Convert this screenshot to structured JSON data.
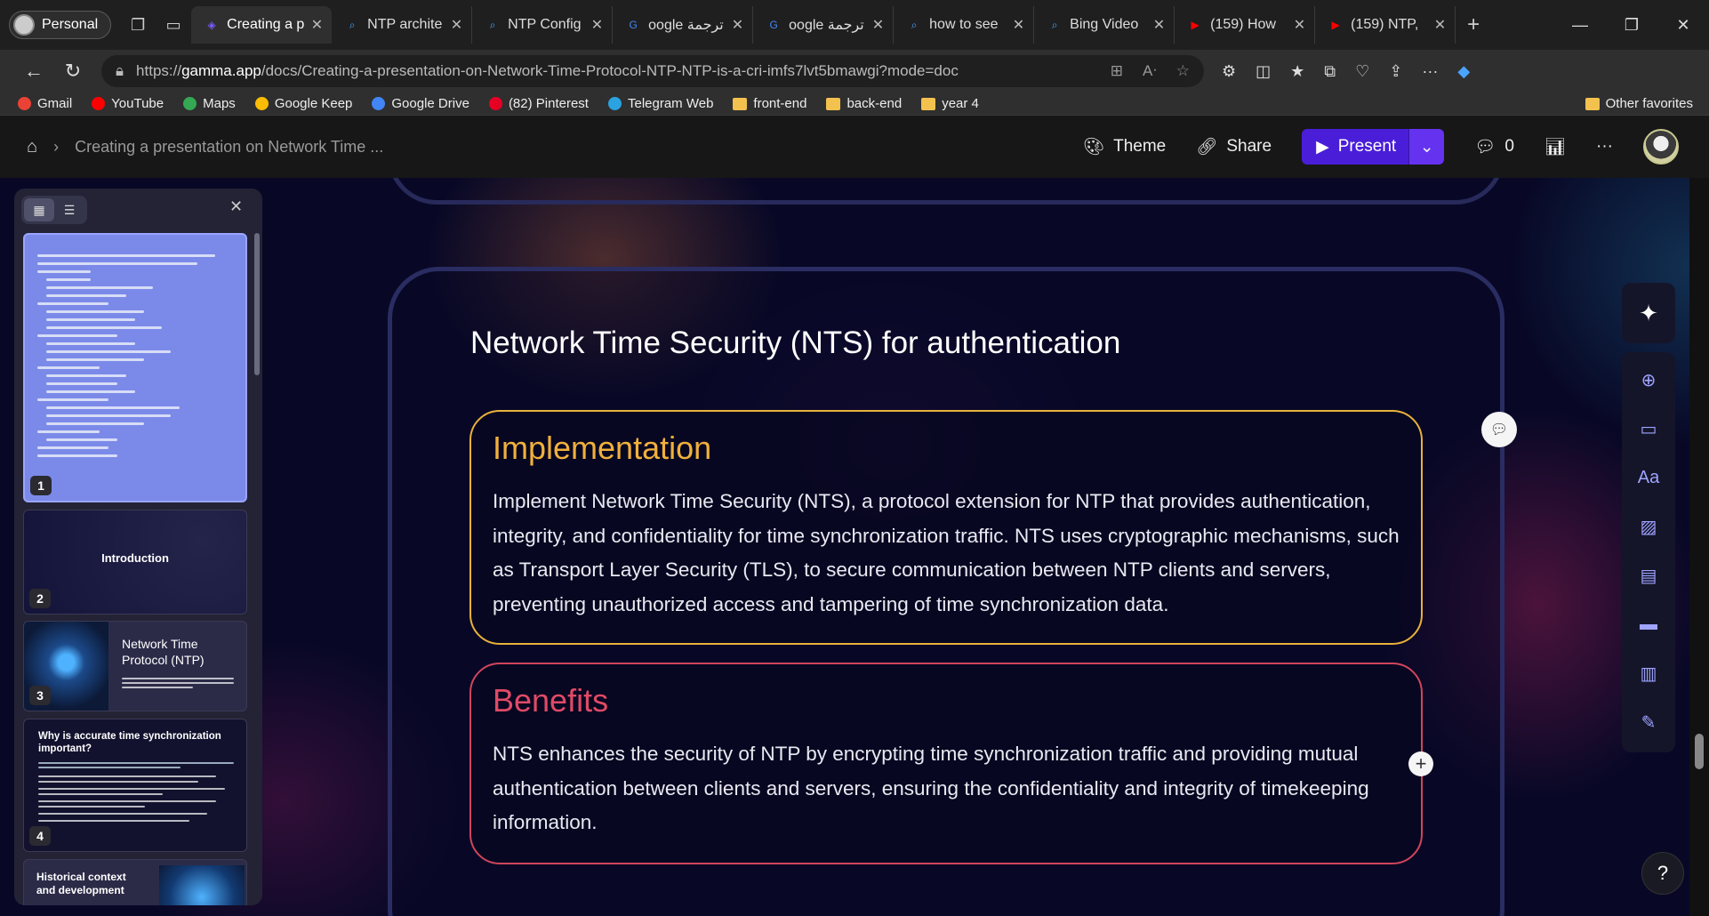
{
  "browser": {
    "profile": "Personal",
    "tabs": [
      {
        "title": "Creating a p",
        "icon": "gamma-icon",
        "active": true
      },
      {
        "title": "NTP archite",
        "icon": "bing-search-icon"
      },
      {
        "title": "NTP Config",
        "icon": "bing-search-icon"
      },
      {
        "title": "oogle ترجمة",
        "icon": "google-translate-icon"
      },
      {
        "title": "oogle ترجمة",
        "icon": "google-translate-icon"
      },
      {
        "title": "how to see",
        "icon": "bing-search-icon"
      },
      {
        "title": "Bing Video",
        "icon": "bing-search-icon"
      },
      {
        "title": "(159) How",
        "icon": "youtube-icon"
      },
      {
        "title": "(159) NTP,",
        "icon": "youtube-icon"
      }
    ],
    "url_prefix": "https://",
    "url_host": "gamma.app",
    "url_path": "/docs/Creating-a-presentation-on-Network-Time-Protocol-NTP-NTP-is-a-cri-imfs7lvt5bmawgi?mode=doc",
    "bookmarks": [
      {
        "label": "Gmail",
        "icon": "gmail-icon",
        "color": "#ea4335"
      },
      {
        "label": "YouTube",
        "icon": "youtube-icon",
        "color": "#ff0000"
      },
      {
        "label": "Maps",
        "icon": "maps-icon",
        "color": "#34a853"
      },
      {
        "label": "Google Keep",
        "icon": "keep-icon",
        "color": "#fbbc04"
      },
      {
        "label": "Google Drive",
        "icon": "drive-icon",
        "color": "#4285f4"
      },
      {
        "label": "(82) Pinterest",
        "icon": "pinterest-icon",
        "color": "#e60023"
      },
      {
        "label": "Telegram Web",
        "icon": "telegram-icon",
        "color": "#2aa3e0"
      },
      {
        "label": "front-end",
        "icon": "folder-icon",
        "color": "#f2c14e"
      },
      {
        "label": "back-end",
        "icon": "folder-icon",
        "color": "#f2c14e"
      },
      {
        "label": "year 4",
        "icon": "folder-icon",
        "color": "#f2c14e"
      }
    ],
    "other_favorites": "Other favorites"
  },
  "app": {
    "breadcrumb": "Creating a presentation on Network Time ...",
    "theme_label": "Theme",
    "share_label": "Share",
    "present_label": "Present",
    "comment_count": "0",
    "accent": "#4a1ed8"
  },
  "panel": {
    "thumbnails": [
      {
        "num": "1",
        "title": ""
      },
      {
        "num": "2",
        "title": "Introduction"
      },
      {
        "num": "3",
        "title": "Network Time Protocol (NTP)"
      },
      {
        "num": "4",
        "title": "Why is accurate time synchronization important?"
      },
      {
        "num": "",
        "title": "Historical context and development"
      }
    ]
  },
  "slide": {
    "title": "Network Time Security (NTS) for authentication",
    "implementation": {
      "heading": "Implementation",
      "body": "Implement Network Time Security (NTS), a protocol extension for NTP that provides authentication, integrity, and confidentiality for time synchronization traffic. NTS uses cryptographic mechanisms, such as Transport Layer Security (TLS), to secure communication between NTP clients and servers, preventing unauthorized access and tampering of time synchronization data.",
      "color": "#f0b03c"
    },
    "benefits": {
      "heading": "Benefits",
      "body": "NTS enhances the security of NTP by encrypting time synchronization traffic and providing mutual authentication between clients and servers, ensuring the confidentiality and integrity of timekeeping information.",
      "color": "#e04a66"
    }
  },
  "help_label": "?"
}
